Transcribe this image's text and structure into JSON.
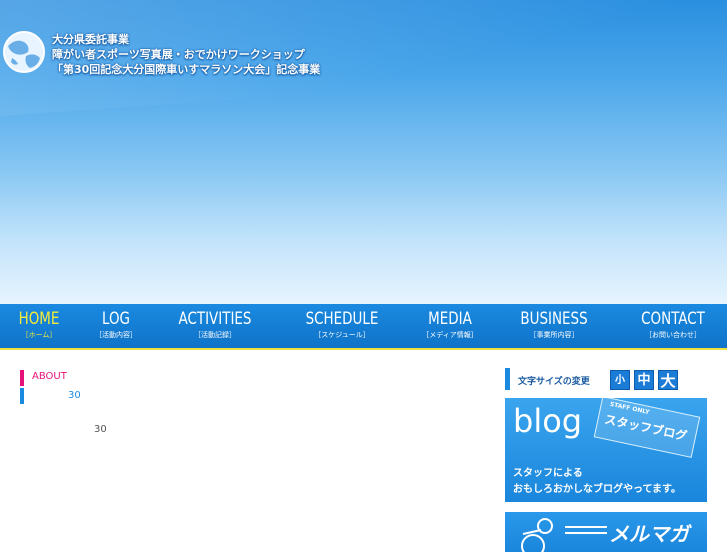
{
  "header": {
    "title_line1": "大分県委託事業",
    "title_line2": "障がい者スポーツ写真展・おでかけワークショップ",
    "title_line3": "「第30回記念大分国際車いすマラソン大会」記念事業"
  },
  "nav": {
    "items": [
      {
        "label": "HOME",
        "sub": "［ホーム］"
      },
      {
        "label": "LOG",
        "sub": "［活動内容］"
      },
      {
        "label": "ACTIVITIES",
        "sub": "［活動記録］"
      },
      {
        "label": "SCHEDULE",
        "sub": "［スケジュール］"
      },
      {
        "label": "MEDIA",
        "sub": "［メディア情報］"
      },
      {
        "label": "BUSINESS",
        "sub": "［事業所内容］"
      },
      {
        "label": "CONTACT",
        "sub": "［お問い合わせ］"
      }
    ]
  },
  "content": {
    "breadcrumb_about": "ABOUT",
    "breadcrumb_num": "30",
    "body_num": "30"
  },
  "sidebar": {
    "font_size_label": "文字サイズの変更",
    "font_small": "小",
    "font_mid": "中",
    "font_large": "大",
    "blog_word": "blog",
    "staff_only": "STAFF ONLY",
    "staff_blog": "スタッフブログ",
    "blog_copy_1": "スタッフによる",
    "blog_copy_2": "おもしろおかしなブログやってます。",
    "mail_word": "メルマガ"
  },
  "colors": {
    "nav_bg": "#0f73c9",
    "active": "#f6ec3a",
    "pink": "#e6127a",
    "blue": "#1a8ae0"
  }
}
